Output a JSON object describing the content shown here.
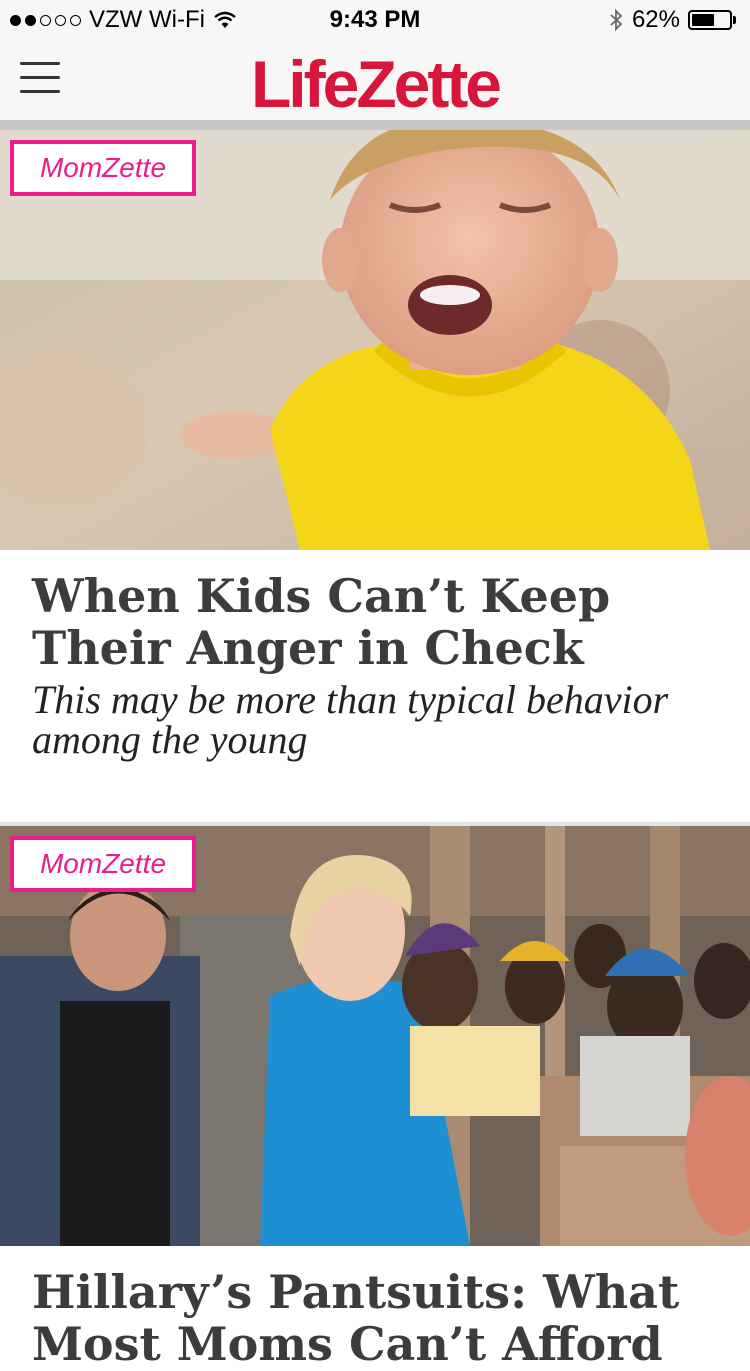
{
  "status_bar": {
    "carrier": "VZW Wi-Fi",
    "time": "9:43 PM",
    "battery": "62%",
    "battery_level": 0.62,
    "signal_bars_filled": 2,
    "signal_bars_total": 5
  },
  "nav": {
    "logo": "LifeZette",
    "logo_color": "#d8153a"
  },
  "articles": [
    {
      "tag": "MomZette",
      "headline": "When Kids Can’t Keep Their Anger in Check",
      "dek": "This may be more than typical behavior among the young"
    },
    {
      "tag": "MomZette",
      "headline": "Hillary’s Pantsuits: What Most Moms Can’t Afford",
      "dek": ""
    }
  ],
  "colors": {
    "tag_accent": "#e91e8c"
  }
}
